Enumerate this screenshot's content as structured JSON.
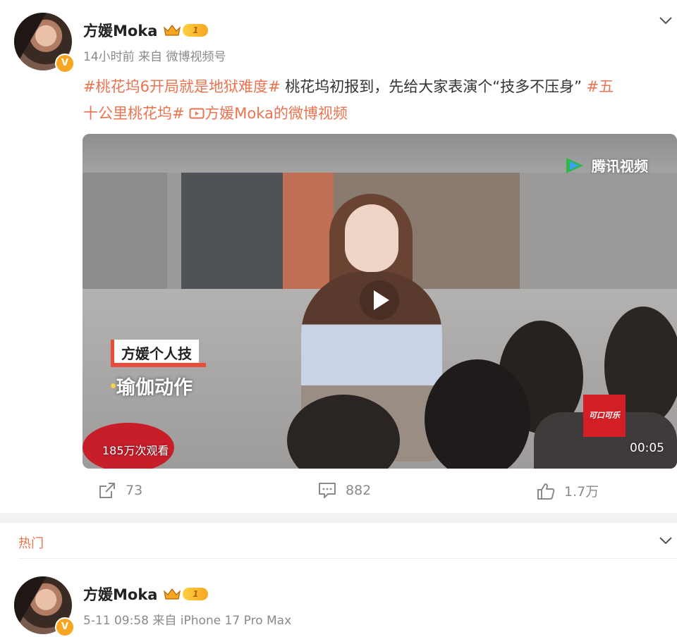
{
  "post": {
    "author": "方媛Moka",
    "vip_level": "1",
    "time": "14小时前",
    "source_prefix": "来自",
    "source": "微博视频号",
    "text": {
      "topic1": "#桃花坞6开局就是地狱难度#",
      "body": " 桃花坞初报到，先给大家表演个“技多不压身” ",
      "topic2_line1": "#五",
      "topic2_line2": "十公里桃花坞#",
      "video_link": "方媛Moka的微博视频"
    },
    "video": {
      "watermark": "腾讯视频",
      "caption_top": "方媛个人技",
      "caption_bottom": "瑜伽动作",
      "sponsor": "可口可乐",
      "views": "185万次观看",
      "duration": "00:05"
    },
    "actions": {
      "reposts": "73",
      "comments": "882",
      "likes": "1.7万"
    }
  },
  "section": {
    "label": "热门"
  },
  "post2": {
    "author": "方媛Moka",
    "vip_level": "1",
    "time": "5-11 09:58",
    "source_prefix": "来自",
    "source": "iPhone 17 Pro Max"
  },
  "colors": {
    "accent": "#eb7350",
    "verified": "#f6a623",
    "meta": "#8a8a8a"
  }
}
